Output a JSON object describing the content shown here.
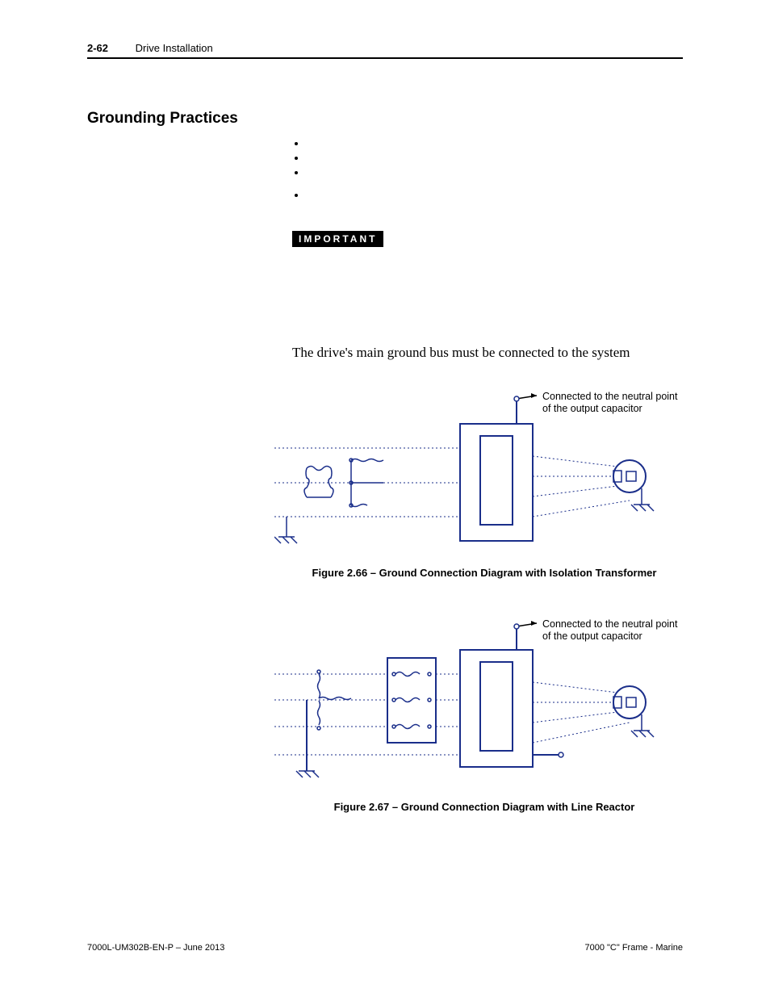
{
  "header": {
    "page_num": "2-62",
    "chapter": "Drive Installation"
  },
  "section_title": "Grounding Practices",
  "important_label": "IMPORTANT",
  "body_text": "The drive's main ground bus must be connected to the system",
  "figures": {
    "a": {
      "annotation": "Connected to the neutral point of the output capacitor",
      "caption": "Figure 2.66 – Ground Connection Diagram with Isolation Transformer"
    },
    "b": {
      "annotation": "Connected to the neutral point of the output capacitor",
      "caption": "Figure 2.67 – Ground Connection Diagram with Line Reactor"
    }
  },
  "footer": {
    "left": "7000L-UM302B-EN-P – June 2013",
    "right": "7000 \"C\" Frame - Marine"
  },
  "colors": {
    "diagram_blue": "#1a2e8a"
  }
}
